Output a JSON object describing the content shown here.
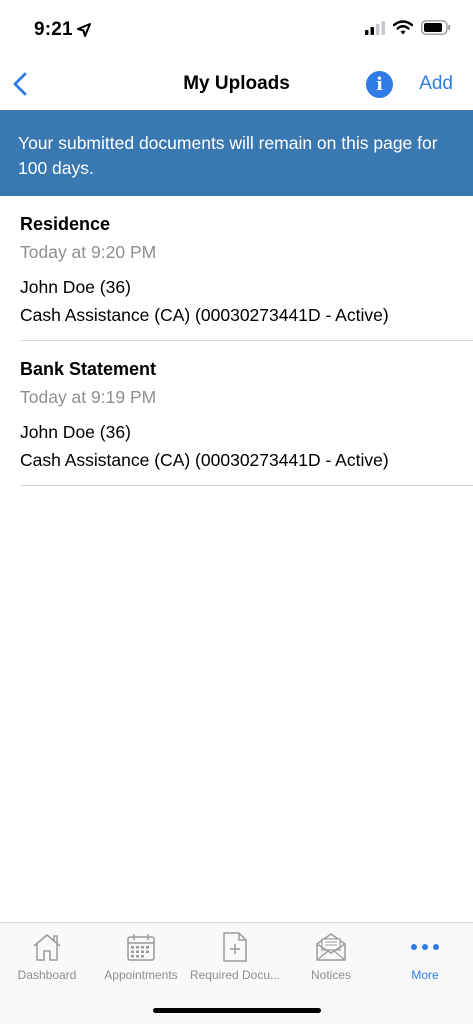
{
  "status": {
    "time": "9:21"
  },
  "nav": {
    "title": "My Uploads",
    "add_label": "Add"
  },
  "banner": {
    "text": "Your submitted documents will remain on this page for 100 days."
  },
  "uploads": [
    {
      "title": "Residence",
      "date": "Today at 9:20 PM",
      "person": "John Doe (36)",
      "program": "Cash Assistance (CA) (00030273441D - Active)"
    },
    {
      "title": "Bank Statement",
      "date": "Today at 9:19 PM",
      "person": "John Doe (36)",
      "program": "Cash Assistance (CA) (00030273441D - Active)"
    }
  ],
  "tabs": [
    {
      "label": "Dashboard",
      "icon": "house-icon",
      "active": false
    },
    {
      "label": "Appointments",
      "icon": "calendar-icon",
      "active": false
    },
    {
      "label": "Required Docu...",
      "icon": "document-add-icon",
      "active": false
    },
    {
      "label": "Notices",
      "icon": "envelope-icon",
      "active": false
    },
    {
      "label": "More",
      "icon": "more-dots-icon",
      "active": true
    }
  ],
  "colors": {
    "accent": "#2f7ce6",
    "banner": "#3a78b1",
    "secondary_text": "#8e8e93"
  }
}
